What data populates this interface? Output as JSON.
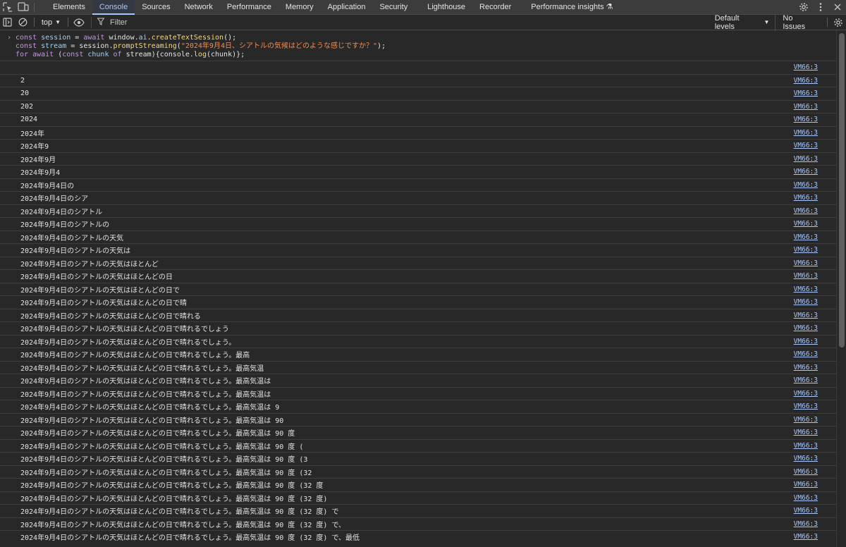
{
  "tabbar": {
    "tabs": [
      "Elements",
      "Console",
      "Sources",
      "Network",
      "Performance",
      "Memory",
      "Application",
      "Security",
      "Lighthouse",
      "Recorder",
      "Performance insights"
    ],
    "active": "Console"
  },
  "toolbar": {
    "context": "top",
    "filter_placeholder": "Filter",
    "levels": "Default levels",
    "issues": "No Issues"
  },
  "input": {
    "line1": {
      "a": "const ",
      "b": "session",
      "c": " = ",
      "d": "await",
      "e": " window.",
      "f": "ai",
      "g": ".",
      "h": "createTextSession",
      "i": "();"
    },
    "line2": {
      "a": "const ",
      "b": "stream",
      "c": " = session.",
      "d": "promptStreaming",
      "e": "(",
      "f": "\"2024年9月4日、シアトルの気候はどのような感じですか？\"",
      "g": ");"
    },
    "line3": {
      "a": "for await",
      "b": " (",
      "c": "const",
      "d": " chunk ",
      "e": "of",
      "f": " stream){console.",
      "g": "log",
      "h": "(chunk)};"
    }
  },
  "source_link": "VM66:3",
  "log_rows": [
    "",
    "2",
    "20",
    "202",
    "2024",
    "2024年",
    "2024年9",
    "2024年9月",
    "2024年9月4",
    "2024年9月4日の",
    "2024年9月4日のシア",
    "2024年9月4日のシアトル",
    "2024年9月4日のシアトルの",
    "2024年9月4日のシアトルの天気",
    "2024年9月4日のシアトルの天気は",
    "2024年9月4日のシアトルの天気はほとんど",
    "2024年9月4日のシアトルの天気はほとんどの日",
    "2024年9月4日のシアトルの天気はほとんどの日で",
    "2024年9月4日のシアトルの天気はほとんどの日で晴",
    "2024年9月4日のシアトルの天気はほとんどの日で晴れる",
    "2024年9月4日のシアトルの天気はほとんどの日で晴れるでしょう",
    "2024年9月4日のシアトルの天気はほとんどの日で晴れるでしょう。",
    "2024年9月4日のシアトルの天気はほとんどの日で晴れるでしょう。最高",
    "2024年9月4日のシアトルの天気はほとんどの日で晴れるでしょう。最高気温",
    "2024年9月4日のシアトルの天気はほとんどの日で晴れるでしょう。最高気温は",
    "2024年9月4日のシアトルの天気はほとんどの日で晴れるでしょう。最高気温は ",
    "2024年9月4日のシアトルの天気はほとんどの日で晴れるでしょう。最高気温は 9",
    "2024年9月4日のシアトルの天気はほとんどの日で晴れるでしょう。最高気温は 90",
    "2024年9月4日のシアトルの天気はほとんどの日で晴れるでしょう。最高気温は 90 度",
    "2024年9月4日のシアトルの天気はほとんどの日で晴れるでしょう。最高気温は 90 度 (",
    "2024年9月4日のシアトルの天気はほとんどの日で晴れるでしょう。最高気温は 90 度 (3",
    "2024年9月4日のシアトルの天気はほとんどの日で晴れるでしょう。最高気温は 90 度 (32",
    "2024年9月4日のシアトルの天気はほとんどの日で晴れるでしょう。最高気温は 90 度 (32 度",
    "2024年9月4日のシアトルの天気はほとんどの日で晴れるでしょう。最高気温は 90 度 (32 度)",
    "2024年9月4日のシアトルの天気はほとんどの日で晴れるでしょう。最高気温は 90 度 (32 度) で",
    "2024年9月4日のシアトルの天気はほとんどの日で晴れるでしょう。最高気温は 90 度 (32 度) で、",
    "2024年9月4日のシアトルの天気はほとんどの日で晴れるでしょう。最高気温は 90 度 (32 度) で、最低"
  ],
  "icons": {
    "inspect": "inspect-element-icon",
    "device": "device-toolbar-icon",
    "sidebar": "sidebar-toggle-icon",
    "clear": "clear-console-icon",
    "eye": "live-expression-icon",
    "filter": "filter-icon",
    "settings": "settings-gear-icon",
    "more": "more-options-icon",
    "close": "close-icon"
  },
  "colors": {
    "active_tab": "#a8c7fa",
    "link": "#a8c7fa",
    "string": "#f28b54",
    "keyword": "#c792ea",
    "function": "#ffd866"
  }
}
